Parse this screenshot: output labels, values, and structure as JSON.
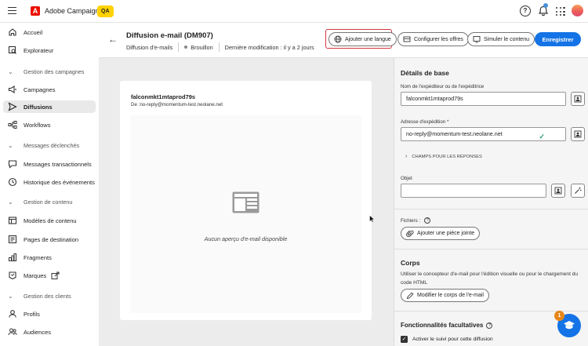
{
  "topbar": {
    "app_title": "Adobe Campaign",
    "env_badge": "QA",
    "help": "?"
  },
  "nav": {
    "items": [
      {
        "label": "Accueil"
      },
      {
        "label": "Explorateur"
      },
      {
        "label": "Gestion des campagnes",
        "section": true
      },
      {
        "label": "Campagnes"
      },
      {
        "label": "Diffusions",
        "active": true
      },
      {
        "label": "Workflows"
      },
      {
        "label": "Messages déclenchés",
        "section": true
      },
      {
        "label": "Messages transactionnels"
      },
      {
        "label": "Historique des événements"
      },
      {
        "label": "Gestion de contenu",
        "section": true
      },
      {
        "label": "Modèles de contenu"
      },
      {
        "label": "Pages de destination"
      },
      {
        "label": "Fragments"
      },
      {
        "label": "Marques"
      },
      {
        "label": "Gestion des clients",
        "section": true
      },
      {
        "label": "Profils"
      },
      {
        "label": "Audiences"
      }
    ]
  },
  "header": {
    "title": "Diffusion e-mail (DM907)",
    "type": "Diffusion d'e-mails",
    "status": "Brouillon",
    "modified": "Dernière modification : il y a 2 jours",
    "btn_language": "Ajouter une langue",
    "btn_offers": "Configurer les offres",
    "btn_simulate": "Simuler le contenu",
    "btn_save": "Enregistrer"
  },
  "preview": {
    "sender_name": "falconmkt1mtaprod79s",
    "sender_from": "De :no-reply@momentum-test.neolane.net",
    "empty_message": "Aucun aperçu d'e-mail disponible"
  },
  "panel": {
    "basic_title": "Détails de base",
    "sender_label": "Nom de l'expéditeur ou de l'expéditrice",
    "sender_value": "falconmkt1mtaprod79s",
    "address_label": "Adresse d'expédition",
    "required_mark": "*",
    "address_value": "no-reply@momentum-test.neolane.net",
    "reply_fields": "CHAMPS POUR LES RÉPONSES",
    "subject_label": "Objet",
    "subject_value": "",
    "files_label": "Fichiers :",
    "attach_btn": "Ajouter une pièce jointe",
    "body_title": "Corps",
    "body_desc": "Utiliser le concepteur d'e-mail pour l'édition visuelle ou pour le chargement du code HTML",
    "edit_body_btn": "Modifier le corps de l'e-mail",
    "optional_title": "Fonctionnalités facultatives",
    "tracking_label": "Activer le suivi pour cette diffusion",
    "tracking_checked": true
  },
  "fab": {
    "badge": "1"
  },
  "colors": {
    "primary": "#1473e6",
    "highlight": "#d7373f",
    "brand": "#eb1000",
    "qa": "#ffd200"
  }
}
